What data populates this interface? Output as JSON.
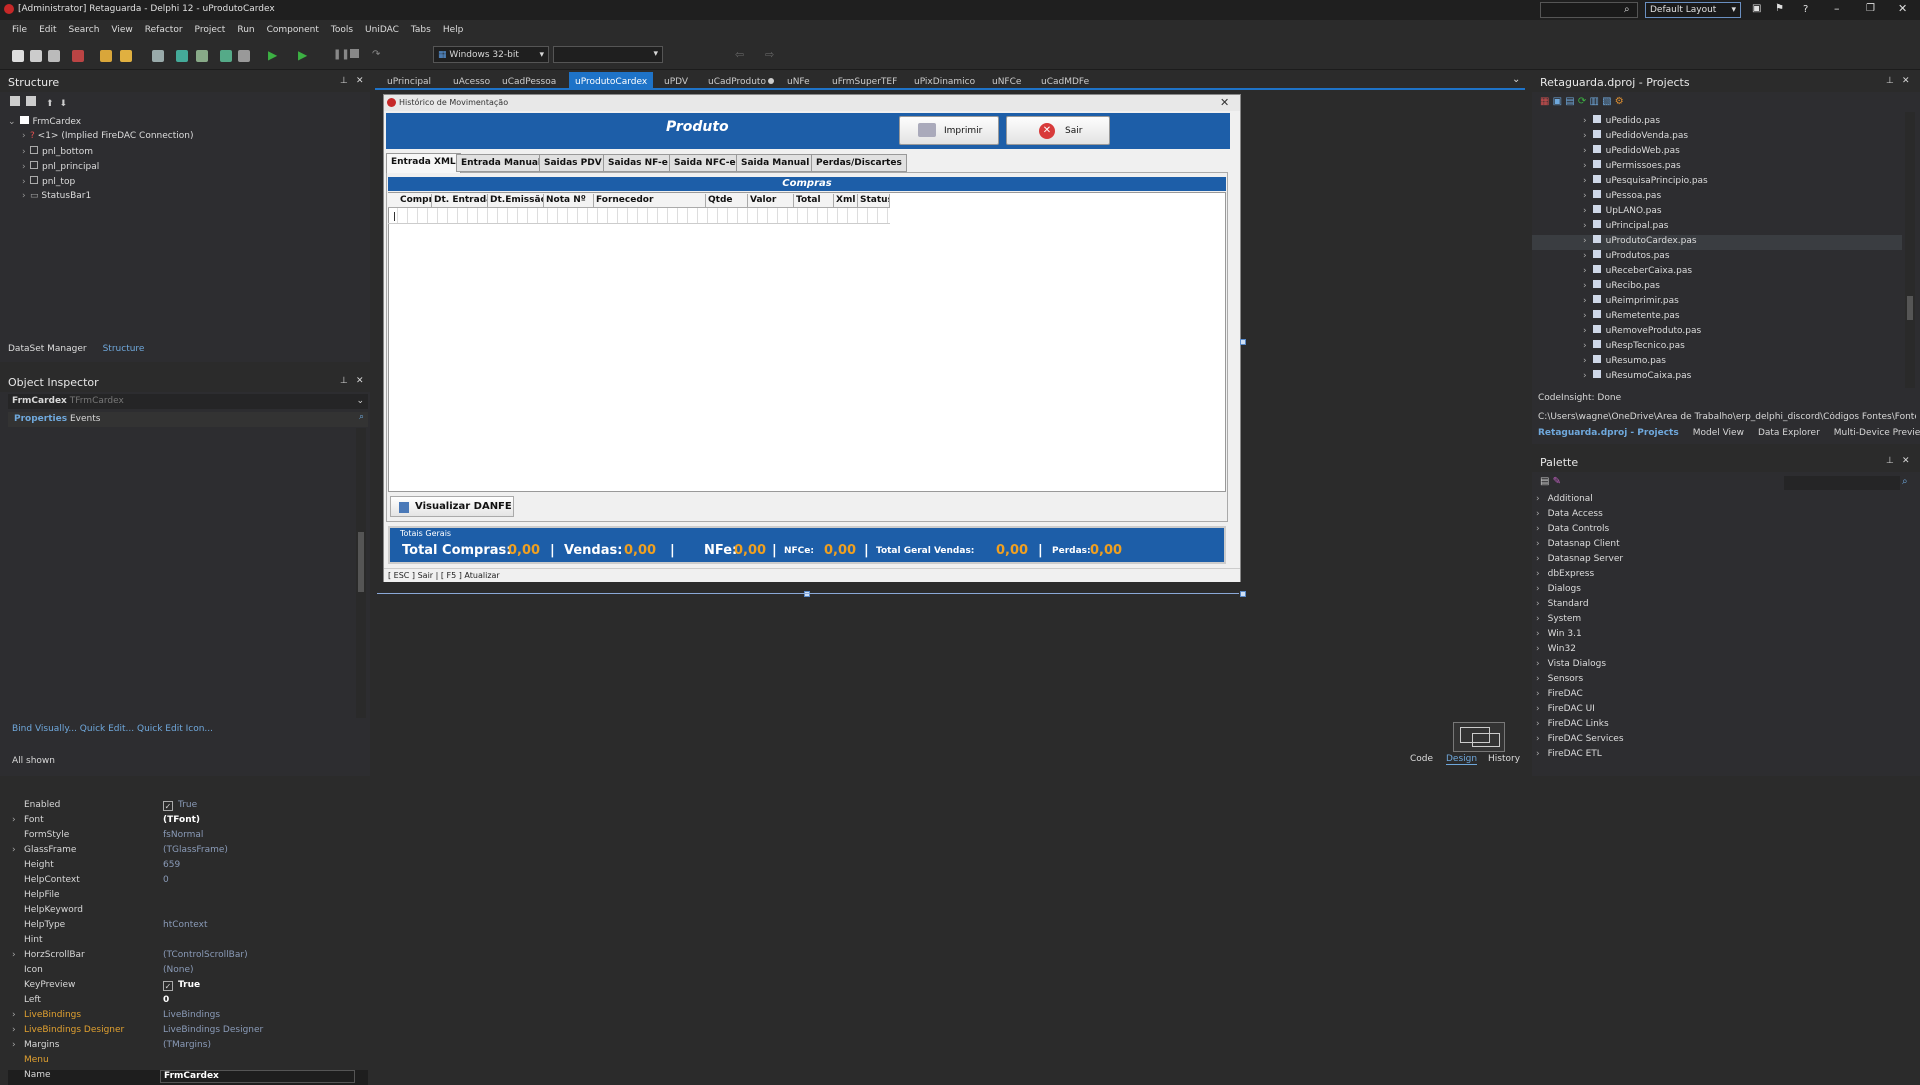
{
  "window": {
    "title": "[Administrator] Retaguarda - Delphi 12 - uProdutoCardex",
    "layout_select": "Default Layout"
  },
  "menu": [
    "File",
    "Edit",
    "Search",
    "View",
    "Refactor",
    "Project",
    "Run",
    "Component",
    "Tools",
    "UniDAC",
    "Tabs",
    "Help"
  ],
  "toolbar": {
    "platform": "Windows 32-bit"
  },
  "structure": {
    "title": "Structure",
    "root": "FrmCardex",
    "items": [
      "<1> (Implied FireDAC Connection)",
      "pnl_bottom",
      "pnl_principal",
      "pnl_top",
      "StatusBar1"
    ],
    "tabs": [
      "DataSet Manager",
      "Structure"
    ]
  },
  "inspector": {
    "title": "Object Inspector",
    "object_name": "FrmCardex",
    "object_type": "TFrmCardex",
    "tabs": [
      "Properties",
      "Events"
    ],
    "rows": [
      {
        "name": "Enabled",
        "value": "True"
      },
      {
        "name": "Font",
        "value": "(TFont)"
      },
      {
        "name": "FormStyle",
        "value": "fsNormal"
      },
      {
        "name": "GlassFrame",
        "value": "(TGlassFrame)"
      },
      {
        "name": "Height",
        "value": "659"
      },
      {
        "name": "HelpContext",
        "value": "0"
      },
      {
        "name": "HelpFile",
        "value": ""
      },
      {
        "name": "HelpKeyword",
        "value": ""
      },
      {
        "name": "HelpType",
        "value": "htContext"
      },
      {
        "name": "Hint",
        "value": ""
      },
      {
        "name": "HorzScrollBar",
        "value": "(TControlScrollBar)"
      },
      {
        "name": "Icon",
        "value": "(None)"
      },
      {
        "name": "KeyPreview",
        "value": "True"
      },
      {
        "name": "Left",
        "value": "0"
      },
      {
        "name": "LiveBindings",
        "value": "LiveBindings"
      },
      {
        "name": "LiveBindings Designer",
        "value": "LiveBindings Designer"
      },
      {
        "name": "Margins",
        "value": "(TMargins)"
      },
      {
        "name": "Menu",
        "value": ""
      },
      {
        "name": "Name",
        "value": "FrmCardex"
      }
    ],
    "links": "Bind Visually...  Quick Edit...  Quick Edit Icon...",
    "status": "All shown"
  },
  "doc_tabs": [
    "uPrincipal",
    "uAcesso",
    "uCadPessoa",
    "uProdutoCardex",
    "uPDV",
    "uCadProduto",
    "uNFe",
    "uFrmSuperTEF",
    "uPixDinamico",
    "uNFCe",
    "uCadMDFe"
  ],
  "form": {
    "caption": "Histórico de Movimentação",
    "header": "Produto",
    "btn_print": "Imprimir",
    "btn_exit": "Sair",
    "tabs": [
      "Entrada XML",
      "Entrada Manual",
      "Saidas PDV",
      "Saidas NF-e",
      "Saida NFC-e",
      "Saida Manual",
      "Perdas/Discartes"
    ],
    "grid_title": "Compras",
    "columns": [
      "Compr",
      "Dt. Entrada",
      "Dt.Emissão",
      "Nota Nº",
      "Fornecedor",
      "Qtde",
      "Valor",
      "Total",
      "Xml",
      "Status"
    ],
    "danfe_btn": "Visualizar DANFE",
    "totals_title": "Totais Gerais",
    "totals": [
      {
        "label": "Total Compras:",
        "value": "0,00"
      },
      {
        "label": "Vendas:",
        "value": "0,00"
      },
      {
        "label": "NFe:",
        "value": "0,00"
      },
      {
        "label": "NFCe:",
        "value": "0,00"
      },
      {
        "label": "Total Geral Vendas:",
        "value": "0,00"
      },
      {
        "label": "Perdas:",
        "value": "0,00"
      }
    ],
    "status": "[ ESC ] Sair | [ F5 ] Atualizar"
  },
  "bottom_tabs": [
    "Code",
    "Design",
    "History"
  ],
  "projects": {
    "title": "Retaguarda.dproj - Projects",
    "files": [
      "uPedido.pas",
      "uPedidoVenda.pas",
      "uPedidoWeb.pas",
      "uPermissoes.pas",
      "uPesquisaPrincipio.pas",
      "uPessoa.pas",
      "UpLANO.pas",
      "uPrincipal.pas",
      "uProdutoCardex.pas",
      "uProdutos.pas",
      "uReceberCaixa.pas",
      "uRecibo.pas",
      "uReimprimir.pas",
      "uRemetente.pas",
      "uRemoveProduto.pas",
      "uRespTecnico.pas",
      "uResumo.pas",
      "uResumoCaixa.pas"
    ],
    "codeinsight": "CodeInsight: Done",
    "path": "C:\\Users\\wagne\\OneDrive\\Área de Trabalho\\erp_delphi_discord\\Códigos Fontes\\Fontes ERP",
    "tabs": [
      "Retaguarda.dproj - Projects",
      "Model View",
      "Data Explorer",
      "Multi-Device Preview"
    ]
  },
  "palette": {
    "title": "Palette",
    "items": [
      "Additional",
      "Data Access",
      "Data Controls",
      "Datasnap Client",
      "Datasnap Server",
      "dbExpress",
      "Dialogs",
      "Standard",
      "System",
      "Win 3.1",
      "Win32",
      "Vista Dialogs",
      "Sensors",
      "FireDAC",
      "FireDAC UI",
      "FireDAC Links",
      "FireDAC Services",
      "FireDAC ETL"
    ]
  }
}
